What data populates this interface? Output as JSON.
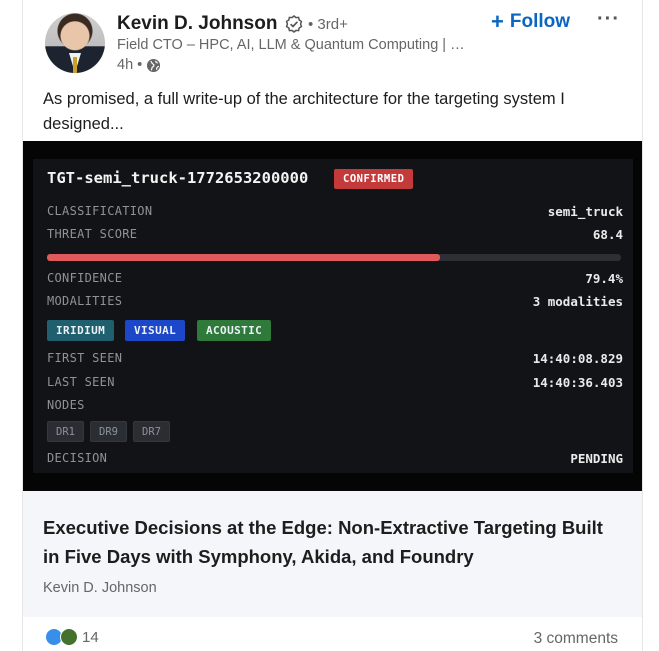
{
  "post": {
    "author_name": "Kevin D. Johnson",
    "degree": "• 3rd+",
    "headline": "Field CTO – HPC, AI, LLM & Quantum Computing | …",
    "time": "4h •",
    "follow_label": "Follow",
    "text": "As promised, a full write-up of the architecture for the targeting system I designed..."
  },
  "target_panel": {
    "title": "TGT-semi_truck-1772653200000",
    "status": "CONFIRMED",
    "status_color": "#c43a3a",
    "classification_label": "CLASSIFICATION",
    "classification_value": "semi_truck",
    "threat_score_label": "THREAT SCORE",
    "threat_score_value": "68.4",
    "threat_score_fraction": 0.684,
    "threat_bar_color": "#e05a5c",
    "confidence_label": "CONFIDENCE",
    "confidence_value": "79.4%",
    "modalities_label": "MODALITIES",
    "modalities_value": "3 modalities",
    "modalities": [
      {
        "label": "IRIDIUM",
        "color": "#1f5f6e"
      },
      {
        "label": "VISUAL",
        "color": "#1d47c9"
      },
      {
        "label": "ACOUSTIC",
        "color": "#2f7a3a"
      }
    ],
    "first_seen_label": "FIRST SEEN",
    "first_seen_value": "14:40:08.829",
    "last_seen_label": "LAST SEEN",
    "last_seen_value": "14:40:36.403",
    "nodes_label": "NODES",
    "nodes": [
      "DR1",
      "DR9",
      "DR7"
    ],
    "decision_label": "DECISION",
    "decision_value": "PENDING"
  },
  "article": {
    "title": "Executive Decisions at the Edge: Non-Extractive Targeting Built in Five Days with Symphony, Akida, and Foundry",
    "author": "Kevin D. Johnson"
  },
  "footer": {
    "reaction_count": "14",
    "comments": "3 comments",
    "reaction_icons": [
      "like-icon",
      "celebrate-icon"
    ]
  },
  "colors": {
    "accent": "#0a66c2"
  }
}
